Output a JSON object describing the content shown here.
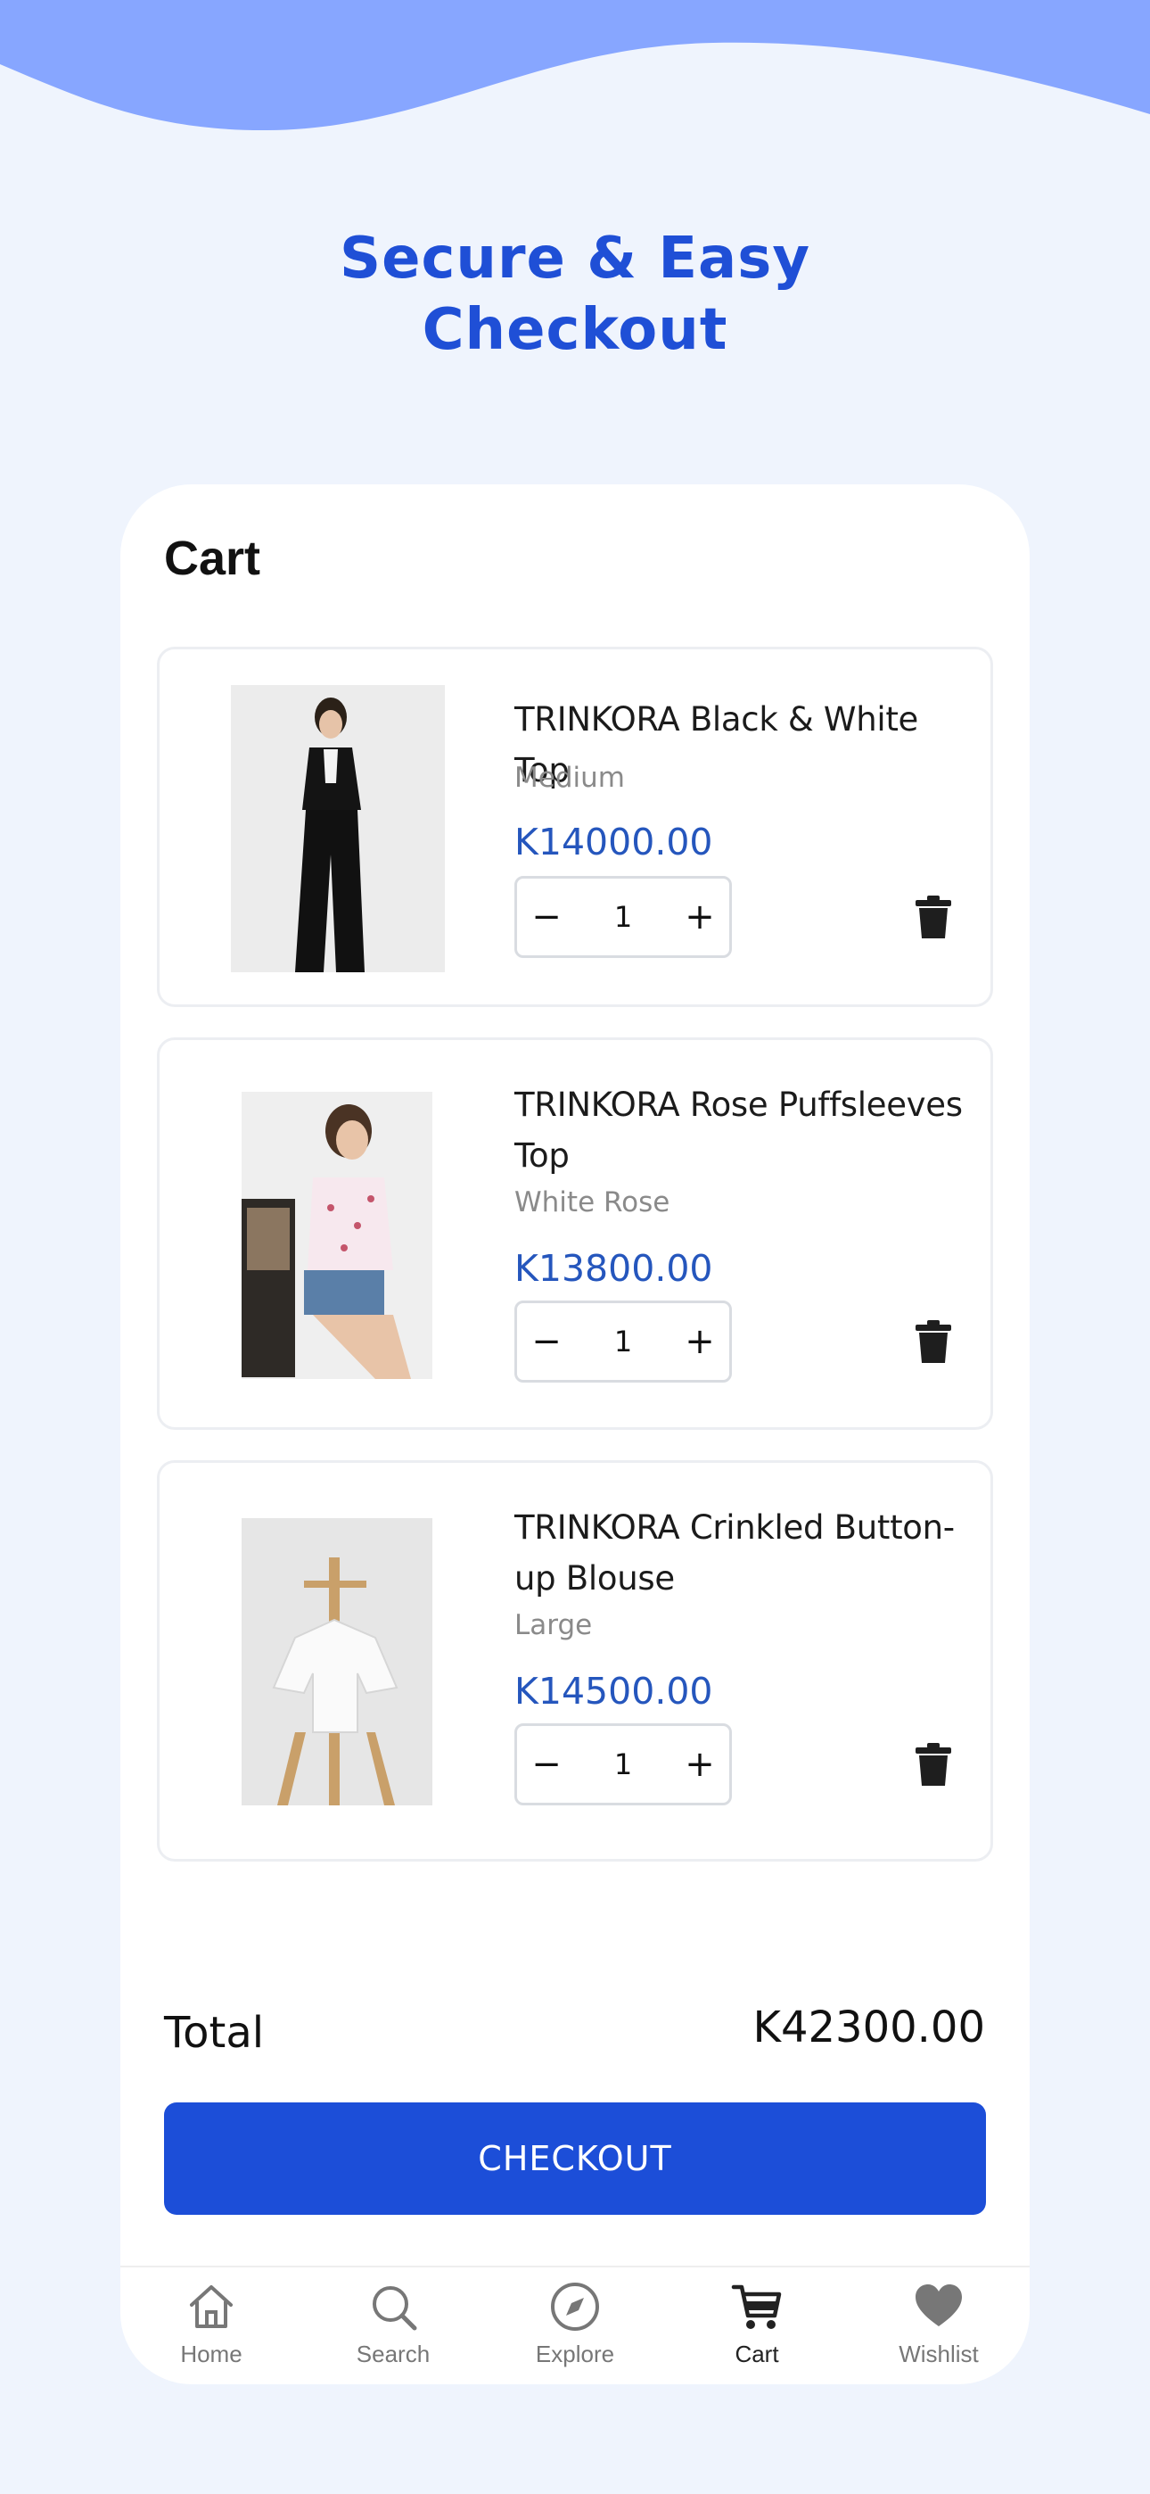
{
  "headline": {
    "line1": "Secure & Easy",
    "line2": "Checkout"
  },
  "colors": {
    "accent": "#1c4ed8",
    "background": "#eff4fd",
    "wave": "#87a6ff",
    "price": "#2556bd"
  },
  "cart": {
    "title": "Cart",
    "items": [
      {
        "name": "TRINKORA Black & White Top",
        "variant": "Medium",
        "price": "K14000.00",
        "qty": "1",
        "image": "woman-black-outfit-photo"
      },
      {
        "name": "TRINKORA Rose Puffsleeves Top",
        "variant": "White Rose",
        "price": "K13800.00",
        "qty": "1",
        "image": "woman-floral-top-photo"
      },
      {
        "name": "TRINKORA Crinkled Button-up Blouse",
        "variant": "Large",
        "price": "K14500.00",
        "qty": "1",
        "image": "white-blouse-on-stand-photo"
      }
    ],
    "minus_glyph": "−",
    "plus_glyph": "+",
    "total_label": "Total",
    "total_value": "K42300.00",
    "checkout_label": "CHECKOUT"
  },
  "nav": {
    "items": [
      {
        "label": "Home",
        "icon": "home-icon"
      },
      {
        "label": "Search",
        "icon": "search-icon"
      },
      {
        "label": "Explore",
        "icon": "compass-icon"
      },
      {
        "label": "Cart",
        "icon": "cart-icon",
        "active": true
      },
      {
        "label": "Wishlist",
        "icon": "heart-icon"
      }
    ]
  }
}
